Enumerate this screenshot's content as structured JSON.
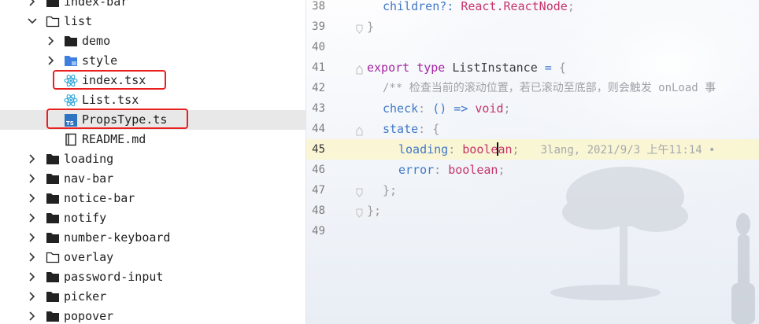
{
  "sidebar": {
    "items": [
      {
        "label": "index-bar",
        "type": "folder"
      },
      {
        "label": "list",
        "type": "folder-open"
      },
      {
        "label": "demo",
        "type": "folder"
      },
      {
        "label": "style",
        "type": "folder-style"
      },
      {
        "label": "index.tsx",
        "type": "react-file"
      },
      {
        "label": "List.tsx",
        "type": "react-file"
      },
      {
        "label": "PropsType.ts",
        "type": "ts-file"
      },
      {
        "label": "README.md",
        "type": "md-file"
      },
      {
        "label": "loading",
        "type": "folder"
      },
      {
        "label": "nav-bar",
        "type": "folder"
      },
      {
        "label": "notice-bar",
        "type": "folder"
      },
      {
        "label": "notify",
        "type": "folder"
      },
      {
        "label": "number-keyboard",
        "type": "folder"
      },
      {
        "label": "overlay",
        "type": "folder-outline"
      },
      {
        "label": "password-input",
        "type": "folder"
      },
      {
        "label": "picker",
        "type": "folder"
      },
      {
        "label": "popover",
        "type": "folder"
      }
    ],
    "ts_badge": "TS"
  },
  "editor": {
    "line_numbers": [
      "38",
      "39",
      "40",
      "41",
      "42",
      "43",
      "44",
      "45",
      "46",
      "47",
      "48",
      "49"
    ],
    "lines": {
      "l38": {
        "prop": "children",
        "opt": "?:",
        "type": "React.ReactNode",
        "end": ";"
      },
      "l39": {
        "text": "}"
      },
      "l41": {
        "kw1": "export",
        "kw2": "type",
        "name": "ListInstance",
        "eq": "=",
        "brace": "{"
      },
      "l42": {
        "comment": "/** 检查当前的滚动位置，若已滚动至底部，则会触发 onLoad 事"
      },
      "l43": {
        "prop": "check",
        "colon": ":",
        "sig": "() => ",
        "type": "void",
        "end": ";"
      },
      "l44": {
        "prop": "state",
        "colon": ":",
        "brace": "{"
      },
      "l45": {
        "prop": "loading",
        "colon": ":",
        "type_a": "boole",
        "type_b": "an",
        "end": ";",
        "blame": "3lang, 2021/9/3 上午11:14 •"
      },
      "l46": {
        "prop": "error",
        "colon": ":",
        "type": "boolean",
        "end": ";"
      },
      "l47": {
        "text": "};"
      },
      "l48": {
        "text": "};"
      }
    }
  },
  "colors": {
    "highlight_box": "#e8201f",
    "current_line": "#faf6ce",
    "selected_row": "#e8e8e8"
  }
}
